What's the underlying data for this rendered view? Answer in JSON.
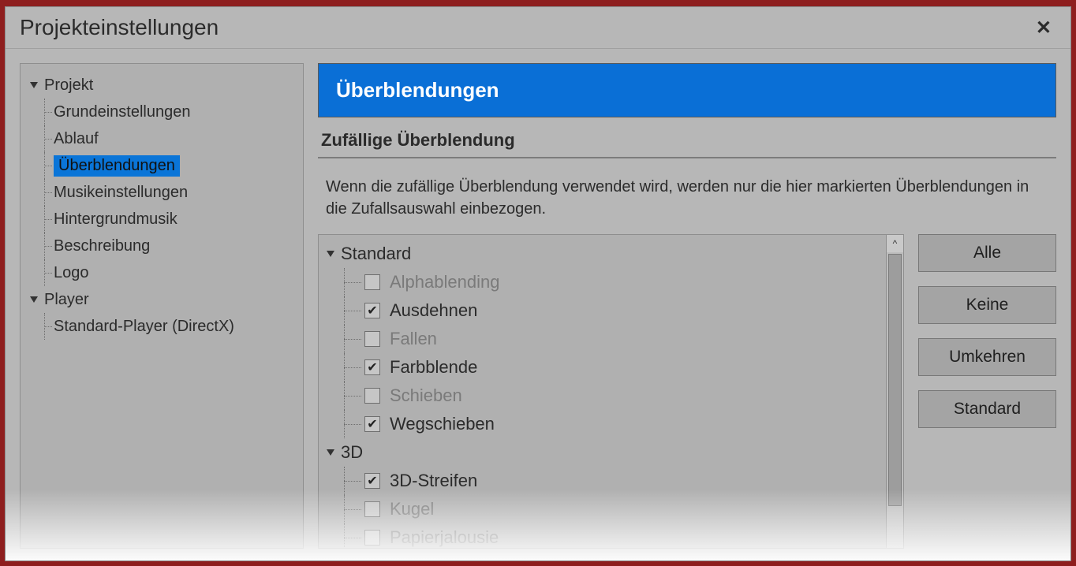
{
  "window": {
    "title": "Projekteinstellungen"
  },
  "sidebar": {
    "groups": [
      {
        "label": "Projekt",
        "children": [
          {
            "label": "Grundeinstellungen"
          },
          {
            "label": "Ablauf"
          },
          {
            "label": "Überblendungen",
            "selected": true
          },
          {
            "label": "Musikeinstellungen"
          },
          {
            "label": "Hintergrundmusik"
          },
          {
            "label": "Beschreibung"
          },
          {
            "label": "Logo"
          }
        ]
      },
      {
        "label": "Player",
        "children": [
          {
            "label": "Standard-Player (DirectX)"
          }
        ]
      }
    ]
  },
  "panel": {
    "header": "Überblendungen",
    "section_title": "Zufällige Überblendung",
    "description": "Wenn die zufällige Überblendung verwendet wird, werden nur die hier markierten Überblendungen in die Zufallsauswahl einbezogen."
  },
  "transitions": {
    "groups": [
      {
        "label": "Standard",
        "items": [
          {
            "label": "Alphablending",
            "checked": false,
            "enabled": false
          },
          {
            "label": "Ausdehnen",
            "checked": true,
            "enabled": true
          },
          {
            "label": "Fallen",
            "checked": false,
            "enabled": false
          },
          {
            "label": "Farbblende",
            "checked": true,
            "enabled": true
          },
          {
            "label": "Schieben",
            "checked": false,
            "enabled": false
          },
          {
            "label": "Wegschieben",
            "checked": true,
            "enabled": true
          }
        ]
      },
      {
        "label": "3D",
        "items": [
          {
            "label": "3D-Streifen",
            "checked": true,
            "enabled": true
          },
          {
            "label": "Kugel",
            "checked": false,
            "enabled": false
          },
          {
            "label": "Papierjalousie",
            "checked": false,
            "enabled": false
          }
        ]
      }
    ]
  },
  "buttons": {
    "all": "Alle",
    "none": "Keine",
    "invert": "Umkehren",
    "default": "Standard"
  }
}
